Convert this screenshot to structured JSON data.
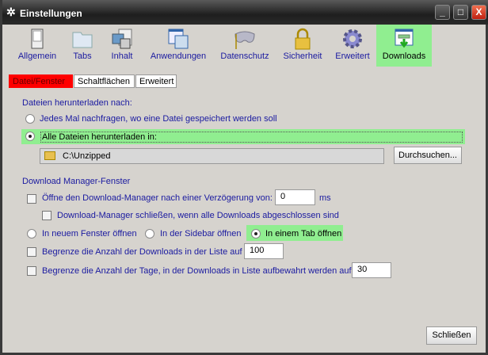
{
  "window": {
    "title": "Einstellungen",
    "minimize": "_",
    "maximize": "□",
    "close": "X"
  },
  "toolbar": [
    {
      "label": "Allgemein",
      "icon": "switch-icon"
    },
    {
      "label": "Tabs",
      "icon": "folder-tabs-icon"
    },
    {
      "label": "Inhalt",
      "icon": "content-icon"
    },
    {
      "label": "Anwendungen",
      "icon": "applications-icon"
    },
    {
      "label": "Datenschutz",
      "icon": "mask-icon"
    },
    {
      "label": "Sicherheit",
      "icon": "lock-icon"
    },
    {
      "label": "Erweitert",
      "icon": "gear-icon"
    },
    {
      "label": "Downloads",
      "icon": "download-icon",
      "selected": true
    }
  ],
  "subtabs": [
    "Datei/Fenster",
    "Schaltflächen",
    "Erweitert"
  ],
  "download_section": {
    "heading": "Dateien herunterladen nach:",
    "option_ask": "Jedes Mal nachfragen, wo eine Datei gespeichert werden soll",
    "option_all": "Alle Dateien herunterladen in:",
    "path": "C:\\Unzipped",
    "browse": "Durchsuchen..."
  },
  "manager_section": {
    "heading": "Download Manager-Fenster",
    "open_delay": "Öffne den Download-Manager nach einer Verzögerung von:",
    "delay_value": "0",
    "delay_unit": "ms",
    "close_when_done": "Download-Manager schließen, wenn alle Downloads abgeschlossen sind",
    "open_new_window": "In neuem Fenster öffnen",
    "open_sidebar": "In der Sidebar öffnen",
    "open_tab": "In einem Tab öffnen",
    "limit_downloads": "Begrenze die Anzahl der Downloads in der Liste auf",
    "limit_downloads_value": "100",
    "limit_days": "Begrenze die Anzahl der Tage, in der Downloads in Liste aufbewahrt werden auf",
    "limit_days_value": "30"
  },
  "footer": {
    "close": "Schließen"
  }
}
